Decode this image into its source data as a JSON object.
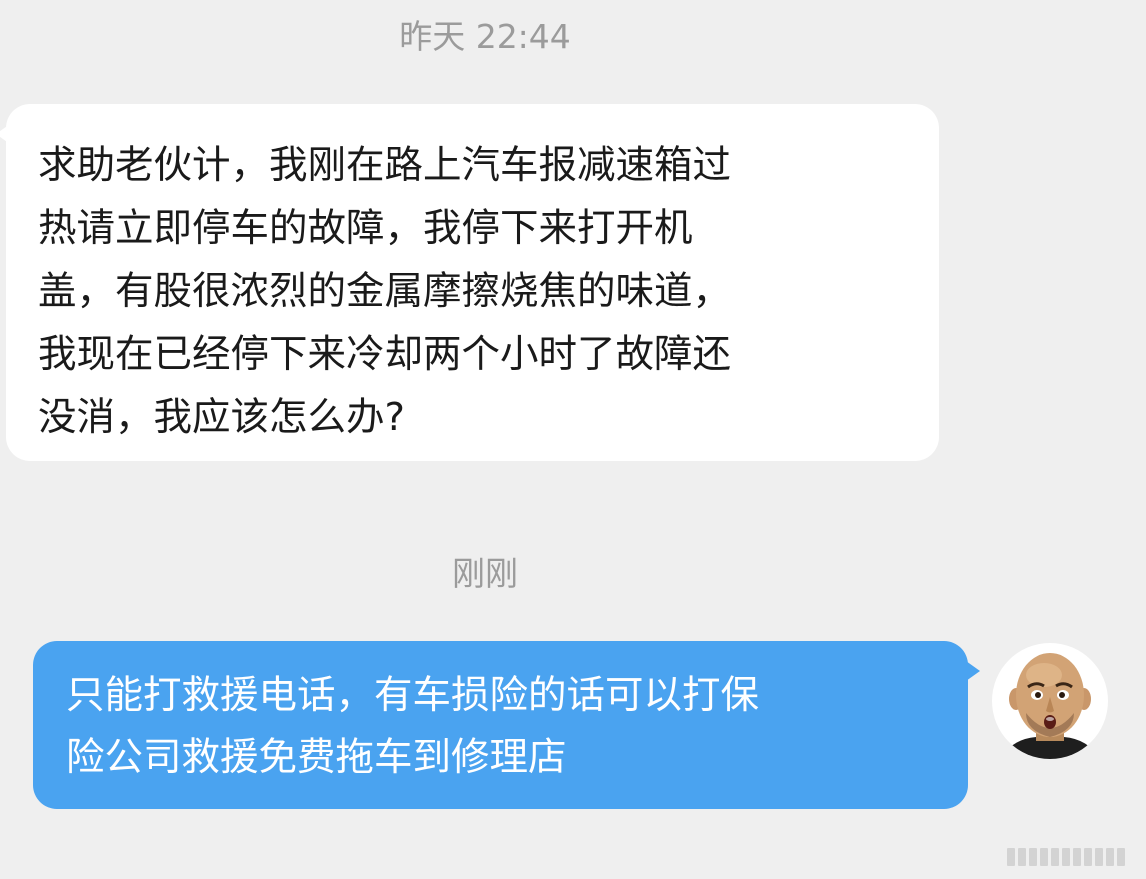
{
  "chat": {
    "messages": [
      {
        "timestamp": "昨天 22:44",
        "sender": "other",
        "lines": [
          "求助老伙计，我刚在路上汽车报减速箱过",
          "热请立即停车的故障，我停下来打开机",
          "盖，有股很浓烈的金属摩擦烧焦的味道，",
          "我现在已经停下来冷却两个小时了故障还",
          "没消，我应该怎么办?"
        ]
      },
      {
        "timestamp": "刚刚",
        "sender": "self",
        "lines": [
          "只能打救援电话，有车损险的话可以打保",
          "险公司救援免费拖车到修理店"
        ]
      }
    ]
  },
  "colors": {
    "background": "#efefef",
    "incoming_bubble": "#ffffff",
    "outgoing_bubble": "#4aa3f0",
    "timestamp_text": "#9b9b9b"
  },
  "icons": {
    "avatar": "bald-man-cartoon-avatar",
    "watermark": "striped-watermark-logo"
  }
}
